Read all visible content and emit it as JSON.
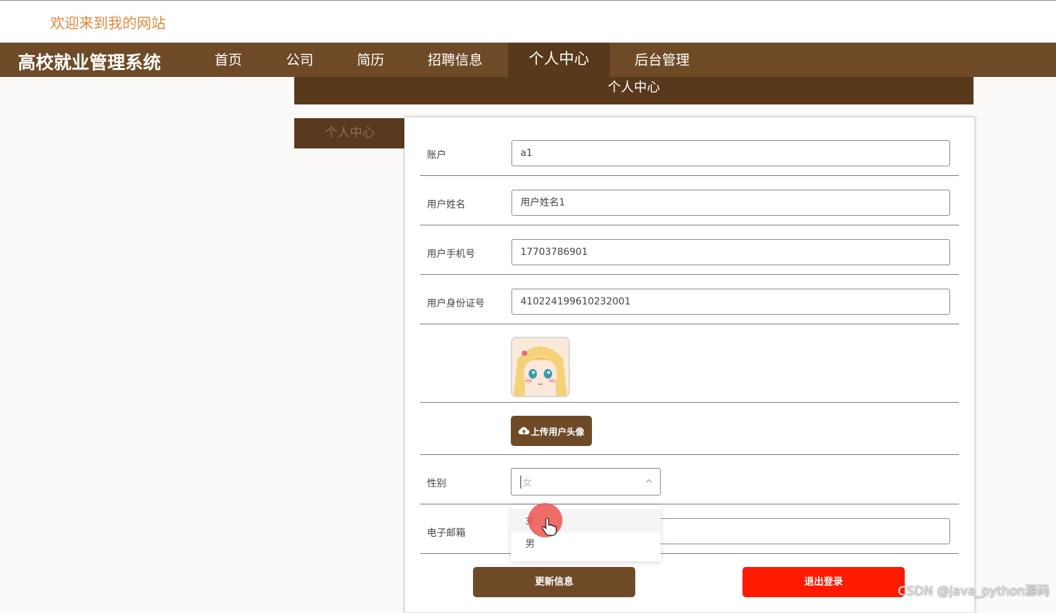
{
  "header": {
    "welcome": "欢迎来到我的网站"
  },
  "navbar": {
    "brand": "高校就业管理系统",
    "items": [
      "首页",
      "公司",
      "简历",
      "招聘信息",
      "个人中心",
      "后台管理"
    ],
    "active": "个人中心"
  },
  "banner": {
    "title": "个人中心"
  },
  "sidebar": {
    "tab": "个人中心"
  },
  "form": {
    "account_label": "账户",
    "account_value": "a1",
    "name_label": "用户姓名",
    "name_value": "用户姓名1",
    "phone_label": "用户手机号",
    "phone_value": "17703786901",
    "idcard_label": "用户身份证号",
    "idcard_value": "410224199610232001",
    "upload_label": "上传用户头像",
    "gender_label": "性别",
    "gender_value": "女",
    "gender_options": [
      "女",
      "男"
    ],
    "email_label": "电子邮箱",
    "email_value": ""
  },
  "buttons": {
    "update": "更新信息",
    "logout": "退出登录"
  },
  "watermark": "CSDN @java_python源码",
  "colors": {
    "nav_bg": "#6e4a27",
    "nav_active": "#58391c",
    "welcome_text": "#e0893e",
    "logout_bg": "#ff1a00"
  },
  "icons": [
    "cloud-upload-icon",
    "chevron-up-icon",
    "hand-pointer-icon"
  ]
}
